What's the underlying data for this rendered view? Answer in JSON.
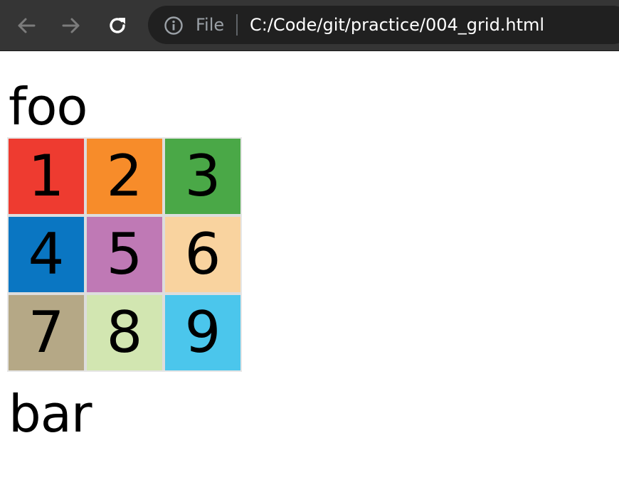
{
  "browser": {
    "scheme_label": "File",
    "url": "C:/Code/git/practice/004_grid.html",
    "icons": {
      "back": "arrow-left-icon",
      "forward": "arrow-right-icon",
      "reload": "reload-icon",
      "info": "info-icon"
    }
  },
  "page": {
    "heading_top": "foo",
    "heading_bottom": "bar",
    "grid": {
      "cells": [
        {
          "label": "1",
          "color": "#ee3b30"
        },
        {
          "label": "2",
          "color": "#f78c2a"
        },
        {
          "label": "3",
          "color": "#4aa847"
        },
        {
          "label": "4",
          "color": "#0a76c2"
        },
        {
          "label": "5",
          "color": "#bf79b5"
        },
        {
          "label": "6",
          "color": "#f9d39f"
        },
        {
          "label": "7",
          "color": "#b5a886"
        },
        {
          "label": "8",
          "color": "#d2e6b1"
        },
        {
          "label": "9",
          "color": "#4bc6ec"
        }
      ]
    }
  }
}
